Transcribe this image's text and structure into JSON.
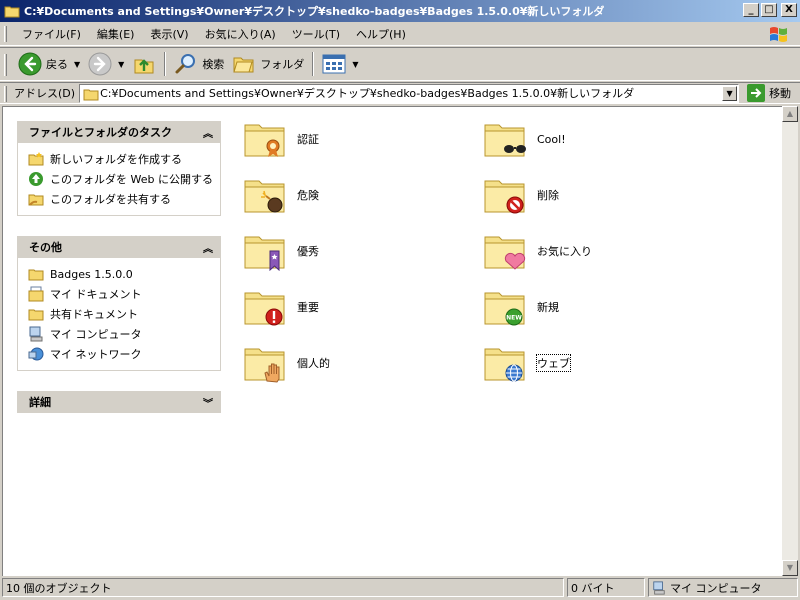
{
  "window": {
    "title": "C:¥Documents and Settings¥Owner¥デスクトップ¥shedko-badges¥Badges 1.5.0.0¥新しいフォルダ",
    "minimize": "_",
    "maximize": "□",
    "close": "X"
  },
  "menu": [
    "ファイル(F)",
    "編集(E)",
    "表示(V)",
    "お気に入り(A)",
    "ツール(T)",
    "ヘルプ(H)"
  ],
  "toolbar": {
    "back_label": "戻る",
    "search_label": "検索",
    "folders_label": "フォルダ"
  },
  "address": {
    "label": "アドレス(D)",
    "value": "C:¥Documents and Settings¥Owner¥デスクトップ¥shedko-badges¥Badges 1.5.0.0¥新しいフォルダ",
    "go_label": "移動"
  },
  "tasks_pane": {
    "title": "ファイルとフォルダのタスク",
    "items": [
      "新しいフォルダを作成する",
      "このフォルダを Web に公開する",
      "このフォルダを共有する"
    ]
  },
  "other_pane": {
    "title": "その他",
    "items": [
      "Badges 1.5.0.0",
      "マイ ドキュメント",
      "共有ドキュメント",
      "マイ コンピュータ",
      "マイ ネットワーク"
    ]
  },
  "details_pane": {
    "title": "詳細"
  },
  "files": [
    {
      "name": "認証",
      "badge": "certificate"
    },
    {
      "name": "Cool!",
      "badge": "sunglasses"
    },
    {
      "name": "危険",
      "badge": "bomb"
    },
    {
      "name": "削除",
      "badge": "no-entry"
    },
    {
      "name": "優秀",
      "badge": "bookmark"
    },
    {
      "name": "お気に入り",
      "badge": "heart"
    },
    {
      "name": "重要",
      "badge": "exclamation"
    },
    {
      "name": "新規",
      "badge": "new"
    },
    {
      "name": "個人的",
      "badge": "hand"
    },
    {
      "name": "ウェブ",
      "badge": "globe"
    }
  ],
  "status": {
    "count": "10 個のオブジェクト",
    "size": "0 バイト",
    "location": "マイ コンピュータ"
  },
  "colors": {
    "titlebar_start": "#0a246a",
    "titlebar_end": "#a6caf0",
    "face": "#d4d0c8",
    "folder": "#f5e08a"
  }
}
